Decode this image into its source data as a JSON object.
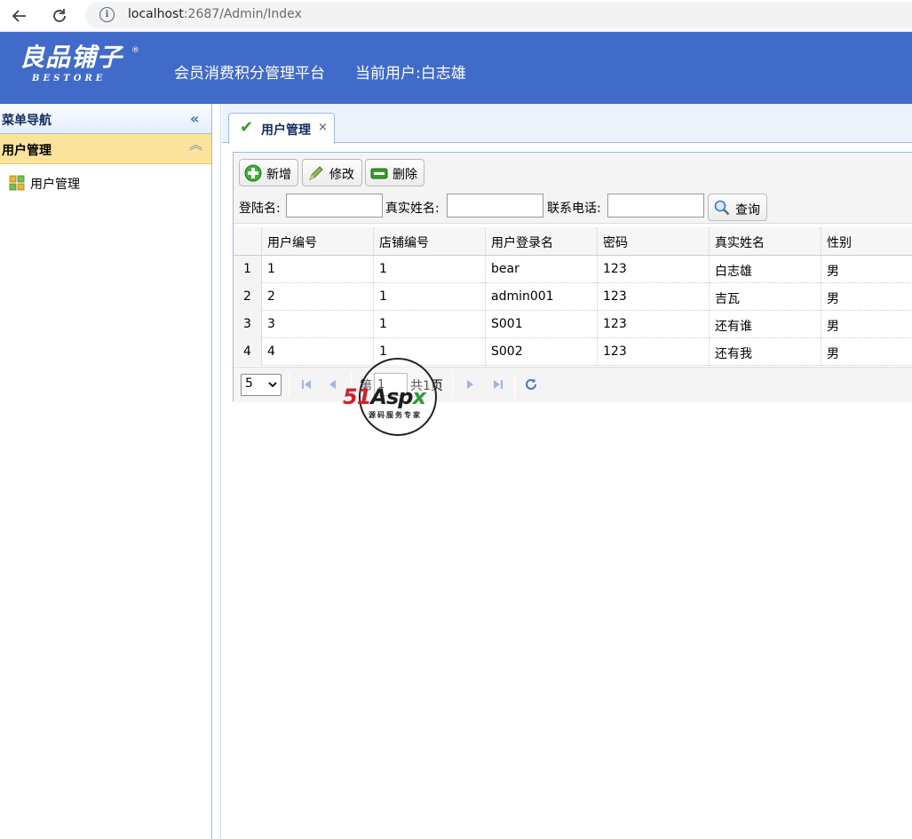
{
  "browser": {
    "url_host": "localhost",
    "url_rest": ":2687/Admin/Index"
  },
  "header": {
    "logo_main": "良品铺子",
    "logo_reg": "®",
    "logo_sub": "BESTORE",
    "title": "会员消费积分管理平台",
    "current_user": "当前用户:白志雄"
  },
  "sidebar": {
    "title": "菜单导航",
    "collapse_icon": "«",
    "group": "用户管理",
    "group_toggle": "︽",
    "items": [
      {
        "label": "用户管理",
        "icon": "grid-app-icon"
      }
    ]
  },
  "tabs": [
    {
      "label": "用户管理",
      "close": "×",
      "icon": "check-icon"
    }
  ],
  "toolbar": {
    "add_label": "新增",
    "edit_label": "修改",
    "delete_label": "删除",
    "search": {
      "login_label": "登陆名:",
      "realname_label": "真实姓名:",
      "phone_label": "联系电话:",
      "login_value": "",
      "realname_value": "",
      "phone_value": "",
      "query_label": "查询"
    }
  },
  "table": {
    "columns": [
      "用户编号",
      "店铺编号",
      "用户登录名",
      "密码",
      "真实姓名",
      "性别"
    ],
    "rows": [
      {
        "num": "1",
        "cells": [
          "1",
          "1",
          "bear",
          "123",
          "白志雄",
          "男"
        ]
      },
      {
        "num": "2",
        "cells": [
          "2",
          "1",
          "admin001",
          "123",
          "吉瓦",
          "男"
        ]
      },
      {
        "num": "3",
        "cells": [
          "3",
          "1",
          "S001",
          "123",
          "还有谁",
          "男"
        ]
      },
      {
        "num": "4",
        "cells": [
          "4",
          "1",
          "S002",
          "123",
          "还有我",
          "男"
        ]
      }
    ]
  },
  "pager": {
    "page_size": "5",
    "page_prefix": "第",
    "page_value": "1",
    "page_total": "共1页"
  },
  "watermark": {
    "part1": "51",
    "part2": "Asp",
    "part3": "x",
    "sub": "源码服务专家"
  },
  "colors": {
    "header_bg": "#416bc9",
    "group_bg": "#fbe39b",
    "border": "#99bbe8"
  }
}
